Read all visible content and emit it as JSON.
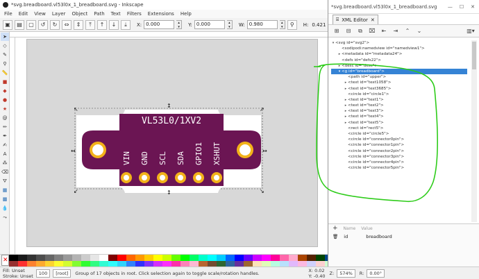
{
  "inkscape": {
    "title": "*svg.breadboard.vl53l0x_1_breadboard.svg - Inkscape",
    "menu": [
      "File",
      "Edit",
      "View",
      "Layer",
      "Object",
      "Path",
      "Text",
      "Filters",
      "Extensions",
      "Help"
    ],
    "coords": {
      "x_label": "X:",
      "x_value": "0.000",
      "y_label": "Y:",
      "y_value": "0.000",
      "w_label": "W:",
      "w_value": "0.980",
      "h_label": "H:",
      "h_value": "0.421"
    }
  },
  "board": {
    "title": "VL53L0/1XV2",
    "pins": [
      "VIN",
      "GND",
      "SCL",
      "SDA",
      "GPIO1",
      "XSHUT"
    ],
    "board_color": "#6b1553",
    "pad_color": "#f2b21a"
  },
  "xml_editor": {
    "title": "*svg.breadboard.vl53l0x_1_breadboard.svg",
    "tab_label": "XML Editor",
    "tree": [
      {
        "text": "<svg id=\"svg2\">",
        "indent": 0,
        "tri": "▾"
      },
      {
        "text": "<sodipodi:namedview id=\"namedview1\">",
        "indent": 1,
        "tri": ""
      },
      {
        "text": "<metadata id=\"metadata24\">",
        "indent": 1,
        "tri": "▸"
      },
      {
        "text": "<defs id=\"defs22\">",
        "indent": 1,
        "tri": ""
      },
      {
        "text": "<desc id=\"desc\">",
        "indent": 1,
        "tri": "▸"
      },
      {
        "text": "<g id=\"breadboard\">",
        "indent": 1,
        "tri": "▾",
        "selected": true
      },
      {
        "text": "<path id=\"upper\">",
        "indent": 2,
        "tri": ""
      },
      {
        "text": "<text id=\"text1058\">",
        "indent": 2,
        "tri": "▸"
      },
      {
        "text": "<text id=\"text3685\">",
        "indent": 2,
        "tri": "▸"
      },
      {
        "text": "<circle id=\"circle1\">",
        "indent": 2,
        "tri": ""
      },
      {
        "text": "<text id=\"text1\">",
        "indent": 2,
        "tri": "▸"
      },
      {
        "text": "<text id=\"text2\">",
        "indent": 2,
        "tri": "▸"
      },
      {
        "text": "<text id=\"text3\">",
        "indent": 2,
        "tri": "▸"
      },
      {
        "text": "<text id=\"text4\">",
        "indent": 2,
        "tri": "▸"
      },
      {
        "text": "<text id=\"text5\">",
        "indent": 2,
        "tri": "▸"
      },
      {
        "text": "<rect id=\"rect5\">",
        "indent": 2,
        "tri": ""
      },
      {
        "text": "<circle id=\"circle5\">",
        "indent": 2,
        "tri": ""
      },
      {
        "text": "<circle id=\"connector0pin\">",
        "indent": 2,
        "tri": ""
      },
      {
        "text": "<circle id=\"connector1pin\">",
        "indent": 2,
        "tri": ""
      },
      {
        "text": "<circle id=\"connector2pin\">",
        "indent": 2,
        "tri": ""
      },
      {
        "text": "<circle id=\"connector3pin\">",
        "indent": 2,
        "tri": ""
      },
      {
        "text": "<circle id=\"connector4pin\">",
        "indent": 2,
        "tri": ""
      },
      {
        "text": "<circle id=\"connector5pin\">",
        "indent": 2,
        "tri": ""
      }
    ],
    "attr_header": {
      "name": "Name",
      "value": "Value"
    },
    "attr_row": {
      "name": "id",
      "value": "breadboard"
    }
  },
  "status": {
    "fill_label": "Fill:",
    "fill_value": "Unset",
    "stroke_label": "Stroke:",
    "stroke_value": "Unset",
    "opacity": "100",
    "layer": "[root]",
    "message": "Group of 17 objects in root. Click selection again to toggle scale/rotation handles.",
    "x_label": "X:",
    "x_value": "0.02",
    "y_label": "Y:",
    "y_value": "-0.40",
    "zoom_label": "Z:",
    "zoom_value": "574%",
    "rot_label": "R:",
    "rot_value": "0.00°"
  },
  "palette_colors": [
    "#000000",
    "#1a1a1a",
    "#333333",
    "#4d4d4d",
    "#666666",
    "#808080",
    "#999999",
    "#b3b3b3",
    "#cccccc",
    "#e6e6e6",
    "#ffffff",
    "#800000",
    "#ff0000",
    "#ff6600",
    "#ff9900",
    "#ffcc00",
    "#ffff00",
    "#ccff00",
    "#66ff00",
    "#00ff00",
    "#00ff66",
    "#00ffcc",
    "#00ffff",
    "#00ccff",
    "#0066ff",
    "#0000ff",
    "#6600ff",
    "#cc00ff",
    "#ff00ff",
    "#ff0099",
    "#ff66aa",
    "#ffaacc",
    "#aa4400",
    "#552200",
    "#004400",
    "#004488",
    "#440088",
    "#884400",
    "#ffddaa",
    "#ddffaa",
    "#aaffdd",
    "#aaddff",
    "#ddaaff",
    "#ffaadd",
    "#c8c8ff",
    "#ffc8c8",
    "#c8ffc8"
  ],
  "accent": "#3583d5",
  "annotation_color": "#2ecc1a"
}
